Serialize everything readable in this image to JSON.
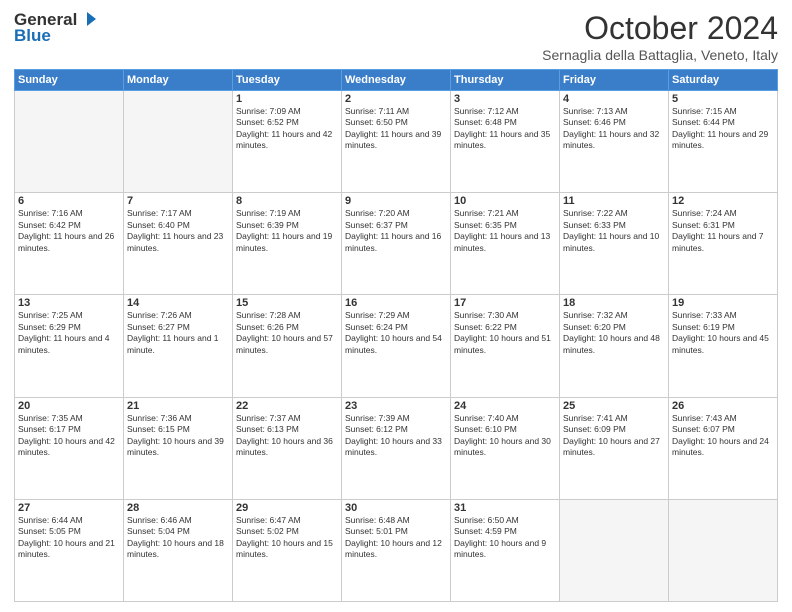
{
  "header": {
    "logo_general": "General",
    "logo_blue": "Blue",
    "month_title": "October 2024",
    "subtitle": "Sernaglia della Battaglia, Veneto, Italy"
  },
  "weekdays": [
    "Sunday",
    "Monday",
    "Tuesday",
    "Wednesday",
    "Thursday",
    "Friday",
    "Saturday"
  ],
  "weeks": [
    [
      {
        "day": "",
        "sunrise": "",
        "sunset": "",
        "daylight": ""
      },
      {
        "day": "",
        "sunrise": "",
        "sunset": "",
        "daylight": ""
      },
      {
        "day": "1",
        "sunrise": "Sunrise: 7:09 AM",
        "sunset": "Sunset: 6:52 PM",
        "daylight": "Daylight: 11 hours and 42 minutes."
      },
      {
        "day": "2",
        "sunrise": "Sunrise: 7:11 AM",
        "sunset": "Sunset: 6:50 PM",
        "daylight": "Daylight: 11 hours and 39 minutes."
      },
      {
        "day": "3",
        "sunrise": "Sunrise: 7:12 AM",
        "sunset": "Sunset: 6:48 PM",
        "daylight": "Daylight: 11 hours and 35 minutes."
      },
      {
        "day": "4",
        "sunrise": "Sunrise: 7:13 AM",
        "sunset": "Sunset: 6:46 PM",
        "daylight": "Daylight: 11 hours and 32 minutes."
      },
      {
        "day": "5",
        "sunrise": "Sunrise: 7:15 AM",
        "sunset": "Sunset: 6:44 PM",
        "daylight": "Daylight: 11 hours and 29 minutes."
      }
    ],
    [
      {
        "day": "6",
        "sunrise": "Sunrise: 7:16 AM",
        "sunset": "Sunset: 6:42 PM",
        "daylight": "Daylight: 11 hours and 26 minutes."
      },
      {
        "day": "7",
        "sunrise": "Sunrise: 7:17 AM",
        "sunset": "Sunset: 6:40 PM",
        "daylight": "Daylight: 11 hours and 23 minutes."
      },
      {
        "day": "8",
        "sunrise": "Sunrise: 7:19 AM",
        "sunset": "Sunset: 6:39 PM",
        "daylight": "Daylight: 11 hours and 19 minutes."
      },
      {
        "day": "9",
        "sunrise": "Sunrise: 7:20 AM",
        "sunset": "Sunset: 6:37 PM",
        "daylight": "Daylight: 11 hours and 16 minutes."
      },
      {
        "day": "10",
        "sunrise": "Sunrise: 7:21 AM",
        "sunset": "Sunset: 6:35 PM",
        "daylight": "Daylight: 11 hours and 13 minutes."
      },
      {
        "day": "11",
        "sunrise": "Sunrise: 7:22 AM",
        "sunset": "Sunset: 6:33 PM",
        "daylight": "Daylight: 11 hours and 10 minutes."
      },
      {
        "day": "12",
        "sunrise": "Sunrise: 7:24 AM",
        "sunset": "Sunset: 6:31 PM",
        "daylight": "Daylight: 11 hours and 7 minutes."
      }
    ],
    [
      {
        "day": "13",
        "sunrise": "Sunrise: 7:25 AM",
        "sunset": "Sunset: 6:29 PM",
        "daylight": "Daylight: 11 hours and 4 minutes."
      },
      {
        "day": "14",
        "sunrise": "Sunrise: 7:26 AM",
        "sunset": "Sunset: 6:27 PM",
        "daylight": "Daylight: 11 hours and 1 minute."
      },
      {
        "day": "15",
        "sunrise": "Sunrise: 7:28 AM",
        "sunset": "Sunset: 6:26 PM",
        "daylight": "Daylight: 10 hours and 57 minutes."
      },
      {
        "day": "16",
        "sunrise": "Sunrise: 7:29 AM",
        "sunset": "Sunset: 6:24 PM",
        "daylight": "Daylight: 10 hours and 54 minutes."
      },
      {
        "day": "17",
        "sunrise": "Sunrise: 7:30 AM",
        "sunset": "Sunset: 6:22 PM",
        "daylight": "Daylight: 10 hours and 51 minutes."
      },
      {
        "day": "18",
        "sunrise": "Sunrise: 7:32 AM",
        "sunset": "Sunset: 6:20 PM",
        "daylight": "Daylight: 10 hours and 48 minutes."
      },
      {
        "day": "19",
        "sunrise": "Sunrise: 7:33 AM",
        "sunset": "Sunset: 6:19 PM",
        "daylight": "Daylight: 10 hours and 45 minutes."
      }
    ],
    [
      {
        "day": "20",
        "sunrise": "Sunrise: 7:35 AM",
        "sunset": "Sunset: 6:17 PM",
        "daylight": "Daylight: 10 hours and 42 minutes."
      },
      {
        "day": "21",
        "sunrise": "Sunrise: 7:36 AM",
        "sunset": "Sunset: 6:15 PM",
        "daylight": "Daylight: 10 hours and 39 minutes."
      },
      {
        "day": "22",
        "sunrise": "Sunrise: 7:37 AM",
        "sunset": "Sunset: 6:13 PM",
        "daylight": "Daylight: 10 hours and 36 minutes."
      },
      {
        "day": "23",
        "sunrise": "Sunrise: 7:39 AM",
        "sunset": "Sunset: 6:12 PM",
        "daylight": "Daylight: 10 hours and 33 minutes."
      },
      {
        "day": "24",
        "sunrise": "Sunrise: 7:40 AM",
        "sunset": "Sunset: 6:10 PM",
        "daylight": "Daylight: 10 hours and 30 minutes."
      },
      {
        "day": "25",
        "sunrise": "Sunrise: 7:41 AM",
        "sunset": "Sunset: 6:09 PM",
        "daylight": "Daylight: 10 hours and 27 minutes."
      },
      {
        "day": "26",
        "sunrise": "Sunrise: 7:43 AM",
        "sunset": "Sunset: 6:07 PM",
        "daylight": "Daylight: 10 hours and 24 minutes."
      }
    ],
    [
      {
        "day": "27",
        "sunrise": "Sunrise: 6:44 AM",
        "sunset": "Sunset: 5:05 PM",
        "daylight": "Daylight: 10 hours and 21 minutes."
      },
      {
        "day": "28",
        "sunrise": "Sunrise: 6:46 AM",
        "sunset": "Sunset: 5:04 PM",
        "daylight": "Daylight: 10 hours and 18 minutes."
      },
      {
        "day": "29",
        "sunrise": "Sunrise: 6:47 AM",
        "sunset": "Sunset: 5:02 PM",
        "daylight": "Daylight: 10 hours and 15 minutes."
      },
      {
        "day": "30",
        "sunrise": "Sunrise: 6:48 AM",
        "sunset": "Sunset: 5:01 PM",
        "daylight": "Daylight: 10 hours and 12 minutes."
      },
      {
        "day": "31",
        "sunrise": "Sunrise: 6:50 AM",
        "sunset": "Sunset: 4:59 PM",
        "daylight": "Daylight: 10 hours and 9 minutes."
      },
      {
        "day": "",
        "sunrise": "",
        "sunset": "",
        "daylight": ""
      },
      {
        "day": "",
        "sunrise": "",
        "sunset": "",
        "daylight": ""
      }
    ]
  ]
}
